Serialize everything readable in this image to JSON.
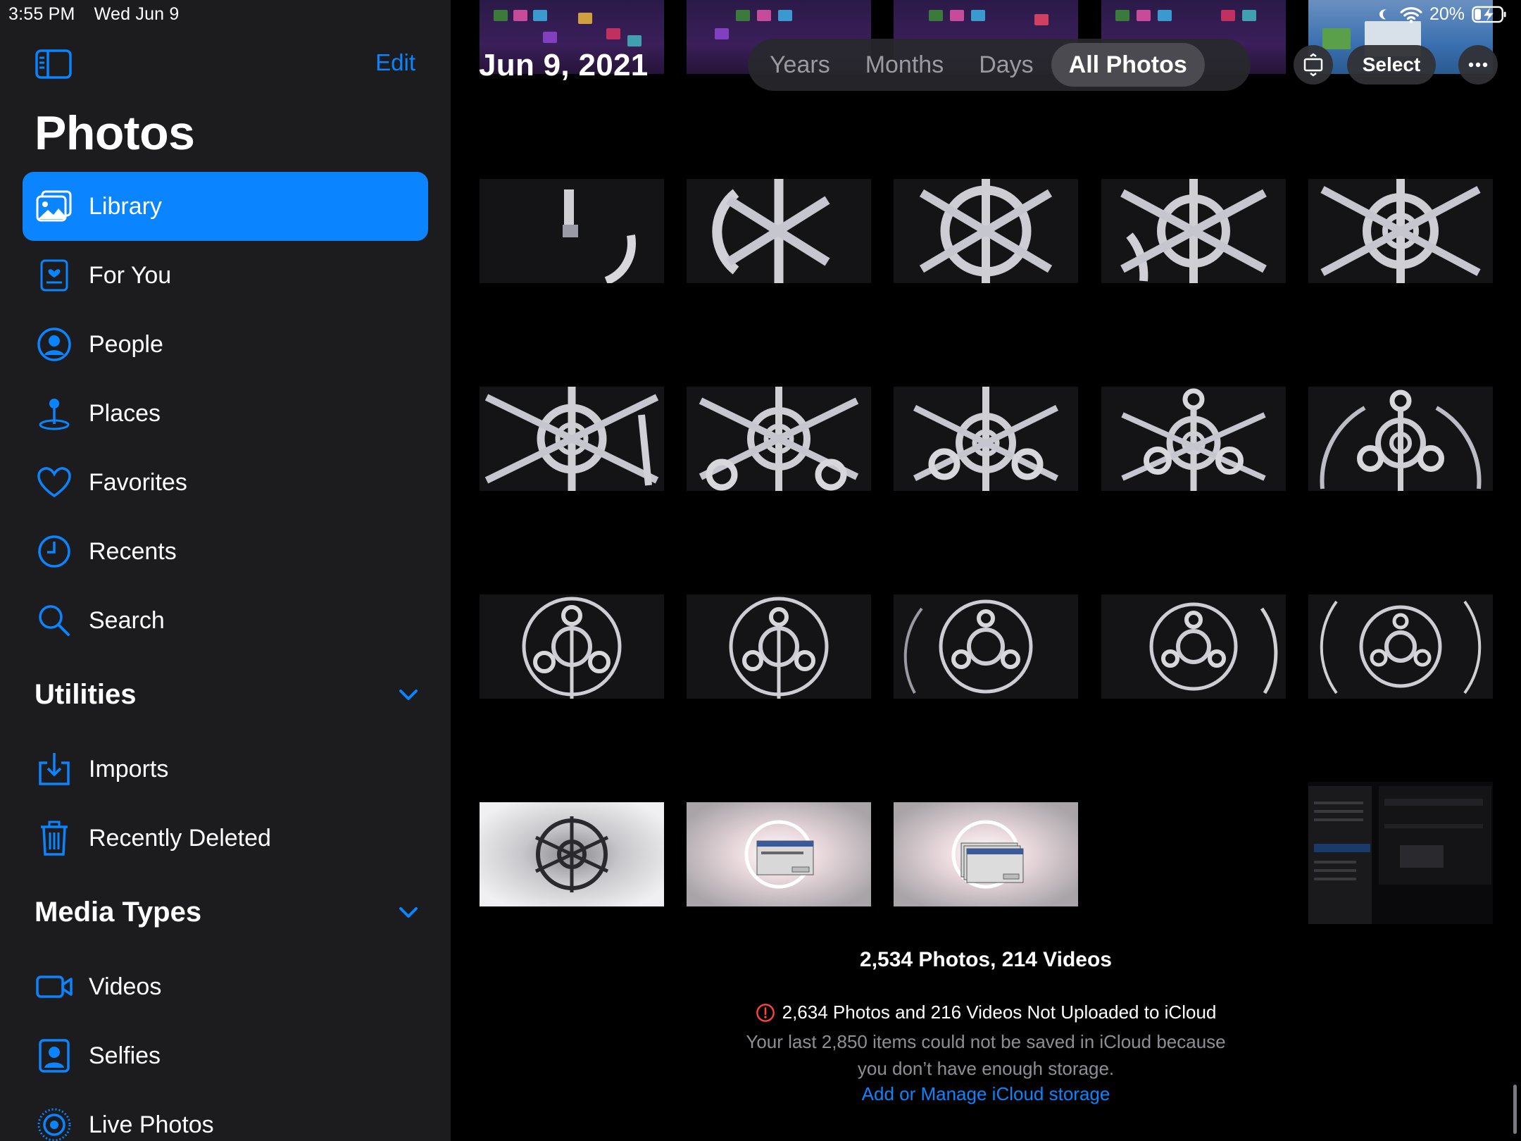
{
  "status": {
    "time": "3:55 PM",
    "date": "Wed Jun 9",
    "battery": "20%"
  },
  "sidebar": {
    "edit_label": "Edit",
    "title": "Photos",
    "items": [
      {
        "label": "Library",
        "icon": "photo-library-icon"
      },
      {
        "label": "For You",
        "icon": "for-you-icon"
      },
      {
        "label": "People",
        "icon": "person-icon"
      },
      {
        "label": "Places",
        "icon": "map-pin-icon"
      },
      {
        "label": "Favorites",
        "icon": "heart-icon"
      },
      {
        "label": "Recents",
        "icon": "clock-icon"
      },
      {
        "label": "Search",
        "icon": "search-icon"
      }
    ],
    "utilities": {
      "title": "Utilities",
      "items": [
        {
          "label": "Imports",
          "icon": "import-icon"
        },
        {
          "label": "Recently Deleted",
          "icon": "trash-icon"
        }
      ]
    },
    "media_types": {
      "title": "Media Types",
      "items": [
        {
          "label": "Videos",
          "icon": "video-icon"
        },
        {
          "label": "Selfies",
          "icon": "selfie-icon"
        },
        {
          "label": "Live Photos",
          "icon": "live-photo-icon"
        }
      ]
    }
  },
  "main": {
    "date_title": "Jun 9, 2021",
    "tabs": [
      "Years",
      "Months",
      "Days",
      "All Photos"
    ],
    "active_tab": "All Photos",
    "select_label": "Select",
    "summary": "2,534 Photos, 214 Videos",
    "warning": "2,634 Photos and 216 Videos Not Uploaded to iCloud",
    "note_line1": "Your last 2,850 items could not be saved in iCloud because",
    "note_line2": "you don’t have enough storage.",
    "link": "Add or Manage iCloud storage"
  },
  "colors": {
    "accent": "#0a84ff",
    "sidebar_bg": "#1c1c1e",
    "warning": "#ff453a"
  }
}
